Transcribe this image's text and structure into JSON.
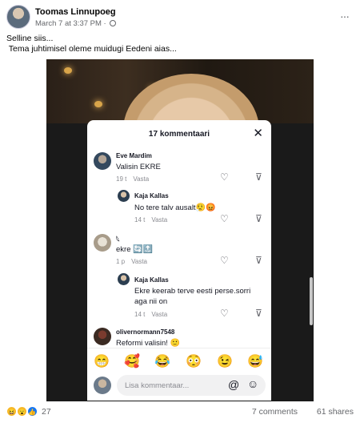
{
  "post": {
    "author": "Toomas Linnupoeg",
    "timestamp": "March 7 at 3:37 PM",
    "separator": "·",
    "more": "···",
    "text_line1": "Selline siis...",
    "text_line2": " Tema juhtimisel oleme muidugi Eedeni aias..."
  },
  "panel": {
    "title": "17 kommentaari",
    "close": "✕",
    "comments": [
      {
        "name": "Eve Mardim",
        "text": "Valisin EKRE",
        "time": "19 t",
        "reply": "Vasta"
      },
      {
        "name": "Kaja Kallas",
        "text": "No tere talv ausalt",
        "emoji": "😮‍💨😡",
        "time": "14 t",
        "reply": "Vasta"
      },
      {
        "name": "𓆩",
        "text": "ekre",
        "emoji": "🔄🔝",
        "time": "1 p",
        "reply": "Vasta"
      },
      {
        "name": "Kaja Kallas",
        "text_line1": "Ekre keerab terve eesti perse.sorri",
        "text_line2": "aga nii on",
        "time": "14 t",
        "reply": "Vasta"
      },
      {
        "name": "olivernormann7548",
        "text": "Reformi valisin!",
        "emoji": "🙂"
      }
    ],
    "emojis": [
      "😁",
      "🥰",
      "😂",
      "😳",
      "😉",
      "😅"
    ],
    "input_placeholder": "Lisa kommentaar...",
    "at_icon": "@",
    "smile_icon": "☺"
  },
  "footer": {
    "reactions": [
      "😆",
      "😮",
      "👍"
    ],
    "reaction_count": "27",
    "comments": "7 comments",
    "shares": "61 shares"
  },
  "colors": {
    "name": "#050505",
    "meta": "#65676b",
    "panel_text": "#161823",
    "muted": "#8a8b91"
  }
}
